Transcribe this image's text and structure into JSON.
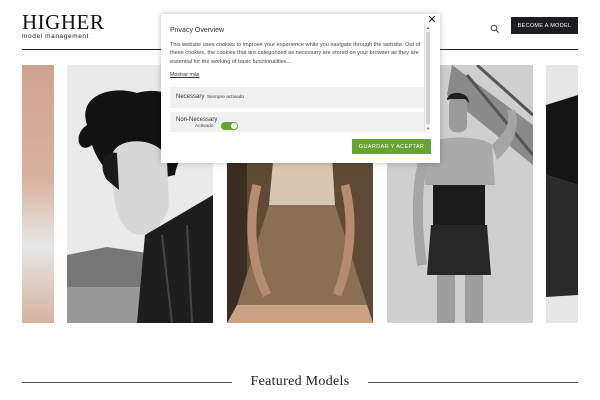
{
  "header": {
    "logo_main": "HIGHER",
    "logo_sub": "model management",
    "become_label": "BECOME A MODEL",
    "search_icon": "search-icon"
  },
  "gallery": {
    "photos": [
      {
        "name": "model-photo-partial-left"
      },
      {
        "name": "model-photo-dark-hair"
      },
      {
        "name": "model-photo-lace-dress"
      },
      {
        "name": "model-photo-corset"
      },
      {
        "name": "model-photo-partial-right"
      }
    ]
  },
  "featured": {
    "title": "Featured Models"
  },
  "cookie_modal": {
    "title": "Privacy Overview",
    "body": "This website uses cookies to improve your experience while you navigate through the website. Out of these cookies, the cookies that are categorized as necessary are stored on your browser as they are essential for the working of basic functionalities...",
    "show_more": "Mostrar más",
    "close_symbol": "✕",
    "necessary_label": "Necessary",
    "necessary_status": "Siempre activado",
    "non_necessary_label": "Non-Necessary",
    "non_necessary_status": "Activado",
    "accept_label": "GUARDAR Y ACEPTAR",
    "accent_color": "#67a331"
  }
}
